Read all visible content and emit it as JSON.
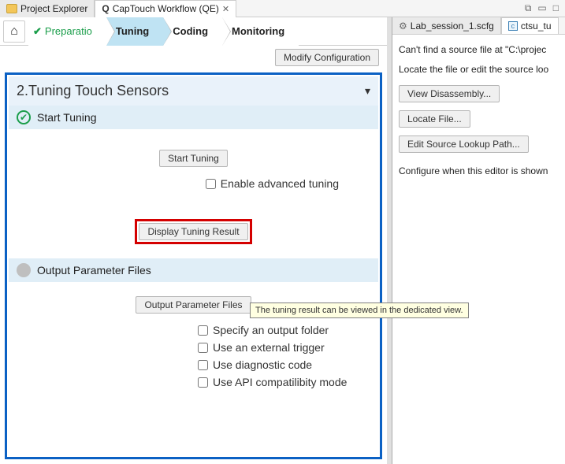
{
  "tabs": {
    "left": [
      {
        "label": "Project Explorer"
      },
      {
        "label": "CapTouch Workflow (QE)",
        "active": true
      }
    ],
    "right": [
      {
        "label": "Lab_session_1.scfg"
      },
      {
        "label": "ctsu_tu"
      }
    ]
  },
  "workflow_nav": {
    "preparation": "Preparatio",
    "tuning": "Tuning",
    "coding": "Coding",
    "monitoring": "Monitoring"
  },
  "modify_btn": "Modify Configuration",
  "panel": {
    "title": "2.Tuning Touch Sensors",
    "start_tuning_header": "Start Tuning",
    "start_tuning_btn": "Start Tuning",
    "enable_adv": "Enable advanced tuning",
    "display_result_btn": "Display Tuning Result",
    "output_header": "Output Parameter Files",
    "output_btn": "Output Parameter Files",
    "chk_specify": "Specify an output folder",
    "chk_trigger": "Use an external trigger",
    "chk_diag": "Use diagnostic code",
    "chk_api": "Use API compatilibity mode"
  },
  "tooltip": "The tuning result can be viewed in the dedicated view.",
  "right": {
    "line1": "Can't find a source file at \"C:\\projec",
    "line2": "Locate the file or edit the source loo",
    "btn_disasm": "View Disassembly...",
    "btn_locate": "Locate File...",
    "btn_edit": "Edit Source Lookup Path...",
    "line3": "Configure when this editor is shown"
  }
}
